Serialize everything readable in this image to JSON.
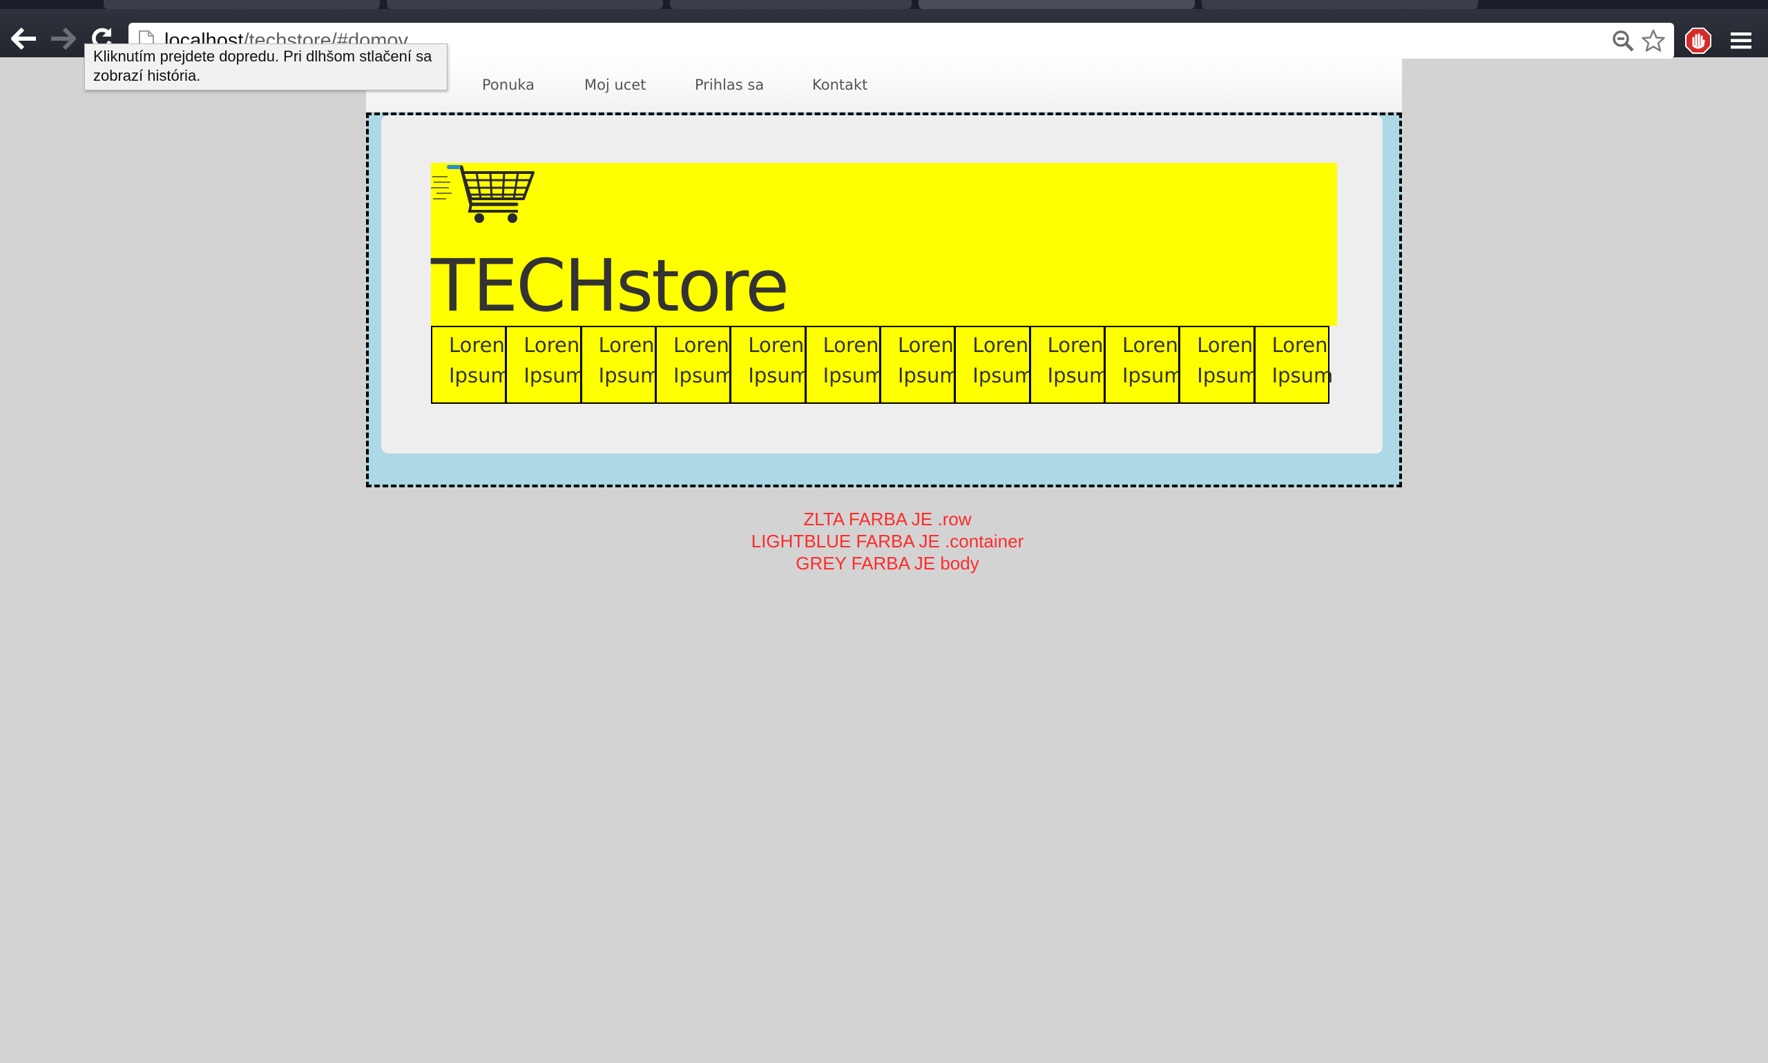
{
  "browser": {
    "url_host": "localhost",
    "url_path": "/techstore/#domov",
    "tooltip": "Kliknutím prejdete dopredu. Pri dlhšom stlačení sa zobrazí história."
  },
  "nav": {
    "items": [
      "Ponuka",
      "Moj ucet",
      "Prihlas sa",
      "Kontakt"
    ]
  },
  "header": {
    "brand": "TECHstore"
  },
  "cells": [
    {
      "line1": "Loren",
      "line2": "Ipsum"
    },
    {
      "line1": "Loren",
      "line2": "Ipsum"
    },
    {
      "line1": "Loren",
      "line2": "Ipsum"
    },
    {
      "line1": "Loren",
      "line2": "Ipsum"
    },
    {
      "line1": "Loren",
      "line2": "Ipsum"
    },
    {
      "line1": "Loren",
      "line2": "Ipsum"
    },
    {
      "line1": "Loren",
      "line2": "Ipsum"
    },
    {
      "line1": "Loren",
      "line2": "Ipsum"
    },
    {
      "line1": "Loren",
      "line2": "Ipsum"
    },
    {
      "line1": "Loren",
      "line2": "Ipsum"
    },
    {
      "line1": "Loren",
      "line2": "Ipsum"
    },
    {
      "line1": "Loren",
      "line2": "Ipsum"
    }
  ],
  "legend": {
    "line1": "ZLTA FARBA JE .row",
    "line2": "LIGHTBLUE FARBA JE .container",
    "line3": "GREY FARBA JE body"
  },
  "colors": {
    "body": "#d3d3d3",
    "container": "#add8e6",
    "row": "#ffff00",
    "legend_text": "#ff2a2a"
  }
}
